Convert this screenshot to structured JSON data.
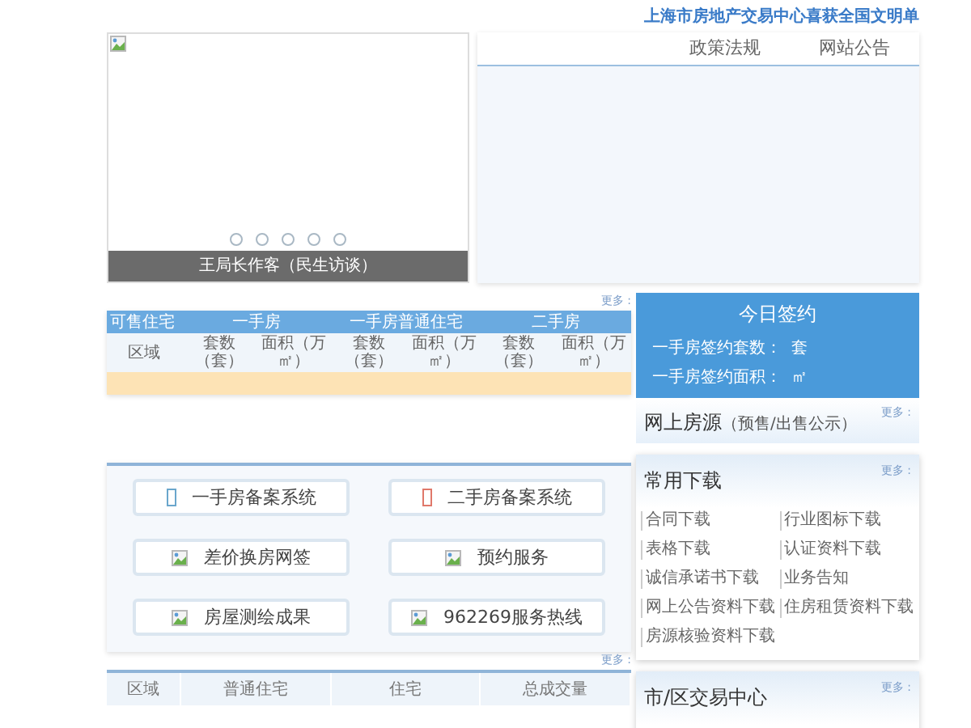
{
  "header_title": "上海市房地产交易中心喜获全国文明单",
  "slider": {
    "caption": "王局长作客（民生访谈）",
    "dots": [
      {
        "selected": false
      },
      {
        "selected": false
      },
      {
        "selected": false
      },
      {
        "selected": false
      },
      {
        "selected": false
      }
    ]
  },
  "news_tabs": [
    {
      "label": "政策法规",
      "selected": false
    },
    {
      "label": "网站公告",
      "selected": false
    }
  ],
  "housing_table": {
    "title": "可售住宅",
    "more": "更多 :",
    "groups": [
      "一手房",
      "一手房普通住宅",
      "二手房"
    ],
    "columns": [
      "区域",
      "套数（套）",
      "面积（万㎡）",
      "套数（套）",
      "面积（万㎡）",
      "套数（套）",
      "面积（万㎡）"
    ]
  },
  "quick_links": [
    {
      "label": "一手房备案系统",
      "kind": "glyph",
      "color": "#6aa6cc"
    },
    {
      "label": "二手房备案系统",
      "kind": "glyph",
      "color": "#e0786a"
    },
    {
      "label": "差价换房网签",
      "kind": "image"
    },
    {
      "label": "预约服务",
      "kind": "image"
    },
    {
      "label": "房屋测绘成果",
      "kind": "image"
    },
    {
      "label": "962269服务热线",
      "kind": "image"
    }
  ],
  "bottom_table": {
    "more": "更多 :",
    "columns": [
      "区域",
      "普通住宅",
      "住宅",
      "总成交量"
    ]
  },
  "today_signing": {
    "title": "今日签约",
    "rows": [
      {
        "label": "一手房签约套数：",
        "unit": "套"
      },
      {
        "label": "一手房签约面积：",
        "unit": "㎡"
      }
    ]
  },
  "online_listings": {
    "title": "网上房源",
    "subtitle": "（预售/出售公示）",
    "more": "更多 :"
  },
  "downloads": {
    "title": "常用下载",
    "more": "更多 :",
    "items": [
      "合同下载",
      "行业图标下载",
      "表格下载",
      "认证资料下载",
      "诚信承诺书下载",
      "业务告知",
      "网上公告资料下载",
      "住房租赁资料下载",
      "房源核验资料下载"
    ]
  },
  "trade_center": {
    "title": "市/区交易中心",
    "more": "更多 :"
  }
}
